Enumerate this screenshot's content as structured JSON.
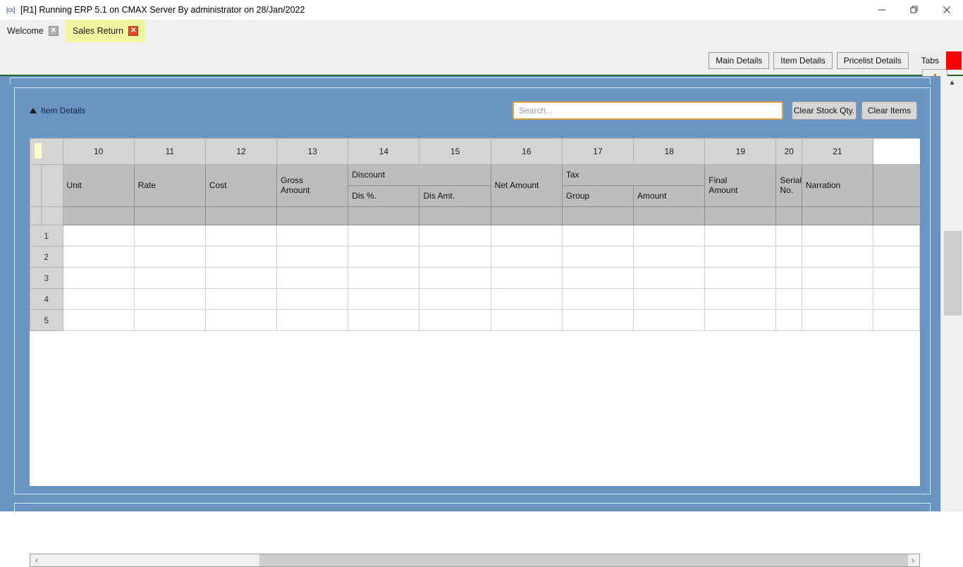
{
  "window": {
    "icon": "app-icon",
    "title": "[R1] Running ERP 5.1 on CMAX Server By administrator on 28/Jan/2022",
    "controls": {
      "minimize": "minimize-icon",
      "maximize": "restore-icon",
      "close": "close-icon"
    }
  },
  "tabs": {
    "items": [
      {
        "label": "Welcome",
        "active": false,
        "close": "✕"
      },
      {
        "label": "Sales Return",
        "active": true,
        "close": "✕"
      }
    ],
    "add_label": "+"
  },
  "toolbar": {
    "buttons": [
      {
        "label": "Main Details"
      },
      {
        "label": "Item Details"
      },
      {
        "label": "Pricelist Details"
      },
      {
        "label": "Tabs"
      }
    ],
    "accent_green": "#1f6b2e",
    "highlight_red": "#fb0000"
  },
  "section": {
    "collapse_icon": "triangle-up-icon",
    "title": "Item Details"
  },
  "search": {
    "value": "",
    "placeholder": "Search...",
    "focus_color": "#e8a33d"
  },
  "actions": {
    "clear_stock_qty": "Clear Stock Qty.",
    "clear_items": "Clear Items"
  },
  "grid": {
    "column_numbers": [
      "10",
      "11",
      "12",
      "13",
      "14",
      "15",
      "16",
      "17",
      "18",
      "19",
      "20",
      "21"
    ],
    "group_headers": [
      {
        "label": "Discount",
        "span": 2
      },
      {
        "label": "Tax",
        "span": 2
      }
    ],
    "headers": [
      "Unit",
      "Rate",
      "Cost",
      "Gross Amount",
      "Discount",
      "Dis %.",
      "Dis Amt.",
      "Net Amount",
      "Tax",
      "Group",
      "Amount",
      "Final Amount",
      "Serial No.",
      "Narration"
    ],
    "header_cells": {
      "unit": "Unit",
      "rate": "Rate",
      "cost": "Cost",
      "gross_amount": "Gross\nAmount",
      "discount": "Discount",
      "dis_pct": "Dis %.",
      "dis_amt": "Dis Amt.",
      "net_amount": "Net Amount",
      "tax": "Tax",
      "tax_group": "Group",
      "tax_amount": "Amount",
      "final_amount": "Final\nAmount",
      "serial_no": "Serial\nNo.",
      "narration": "Narration"
    },
    "row_numbers": [
      "1",
      "2",
      "3",
      "4",
      "5"
    ],
    "rows": [
      {
        "num": "1",
        "cells": [
          "",
          "",
          "",
          "",
          "",
          "",
          "",
          "",
          "",
          "",
          "",
          "",
          "",
          ""
        ]
      },
      {
        "num": "2",
        "cells": [
          "",
          "",
          "",
          "",
          "",
          "",
          "",
          "",
          "",
          "",
          "",
          "",
          "",
          ""
        ]
      },
      {
        "num": "3",
        "cells": [
          "",
          "",
          "",
          "",
          "",
          "",
          "",
          "",
          "",
          "",
          "",
          "",
          "",
          ""
        ]
      },
      {
        "num": "4",
        "cells": [
          "",
          "",
          "",
          "",
          "",
          "",
          "",
          "",
          "",
          "",
          "",
          "",
          "",
          ""
        ]
      },
      {
        "num": "5",
        "cells": [
          "",
          "",
          "",
          "",
          "",
          "",
          "",
          "",
          "",
          "",
          "",
          "",
          "",
          ""
        ]
      }
    ]
  },
  "scrollbars": {
    "horizontal": {
      "left_arrow": "‹",
      "right_arrow": "›"
    },
    "vertical": {
      "up_arrow": "▲"
    }
  },
  "theme": {
    "panel_blue": "#6a95c2",
    "header_gray": "#d4d4d4",
    "subheader_gray": "#bdbdbd",
    "active_tab_yellow": "#f2f5a0"
  }
}
